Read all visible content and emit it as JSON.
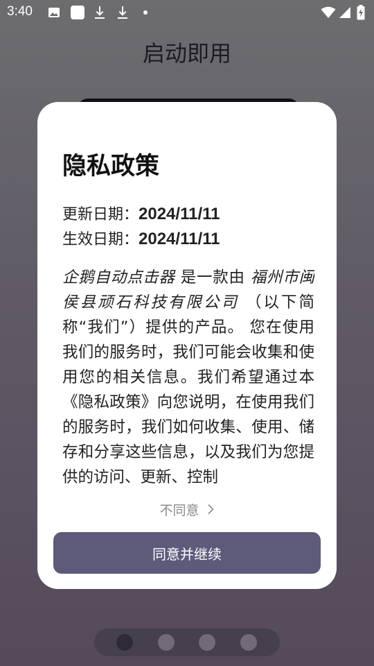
{
  "status_bar": {
    "time": "3:40",
    "left_icons": [
      "image-icon",
      "app-icon",
      "download-icon",
      "download-icon",
      "dot-icon"
    ],
    "right_icons": [
      "wifi-icon",
      "signal-icon",
      "battery-charging-icon"
    ]
  },
  "page": {
    "title": "启动即用"
  },
  "dialog": {
    "title": "隐私政策",
    "update_label": "更新日期：",
    "update_value": "2024/11/11",
    "effective_label": "生效日期：",
    "effective_value": "2024/11/11",
    "body": {
      "app_name": "企鹅自动点击器",
      "text_1": " 是一款由 ",
      "company": "福州市闽侯县顽石科技有限公司",
      "text_2": " （以下简称“我们”）提供的产品。 您在使用我们的服务时，我们可能会收集和使用您的相关信息。我们希望通过本《隐私政策》向您说明，在使用我们的服务时，我们如何收集、使用、储存和分享这些信息，以及我们为您提供的访问、更新、控制"
    },
    "disagree_label": "不同意",
    "agree_label": "同意并继续"
  },
  "pager": {
    "count": 4,
    "active_index": 0
  },
  "colors": {
    "accent": "#5d5a7a",
    "dialog_bg": "#ffffff"
  }
}
